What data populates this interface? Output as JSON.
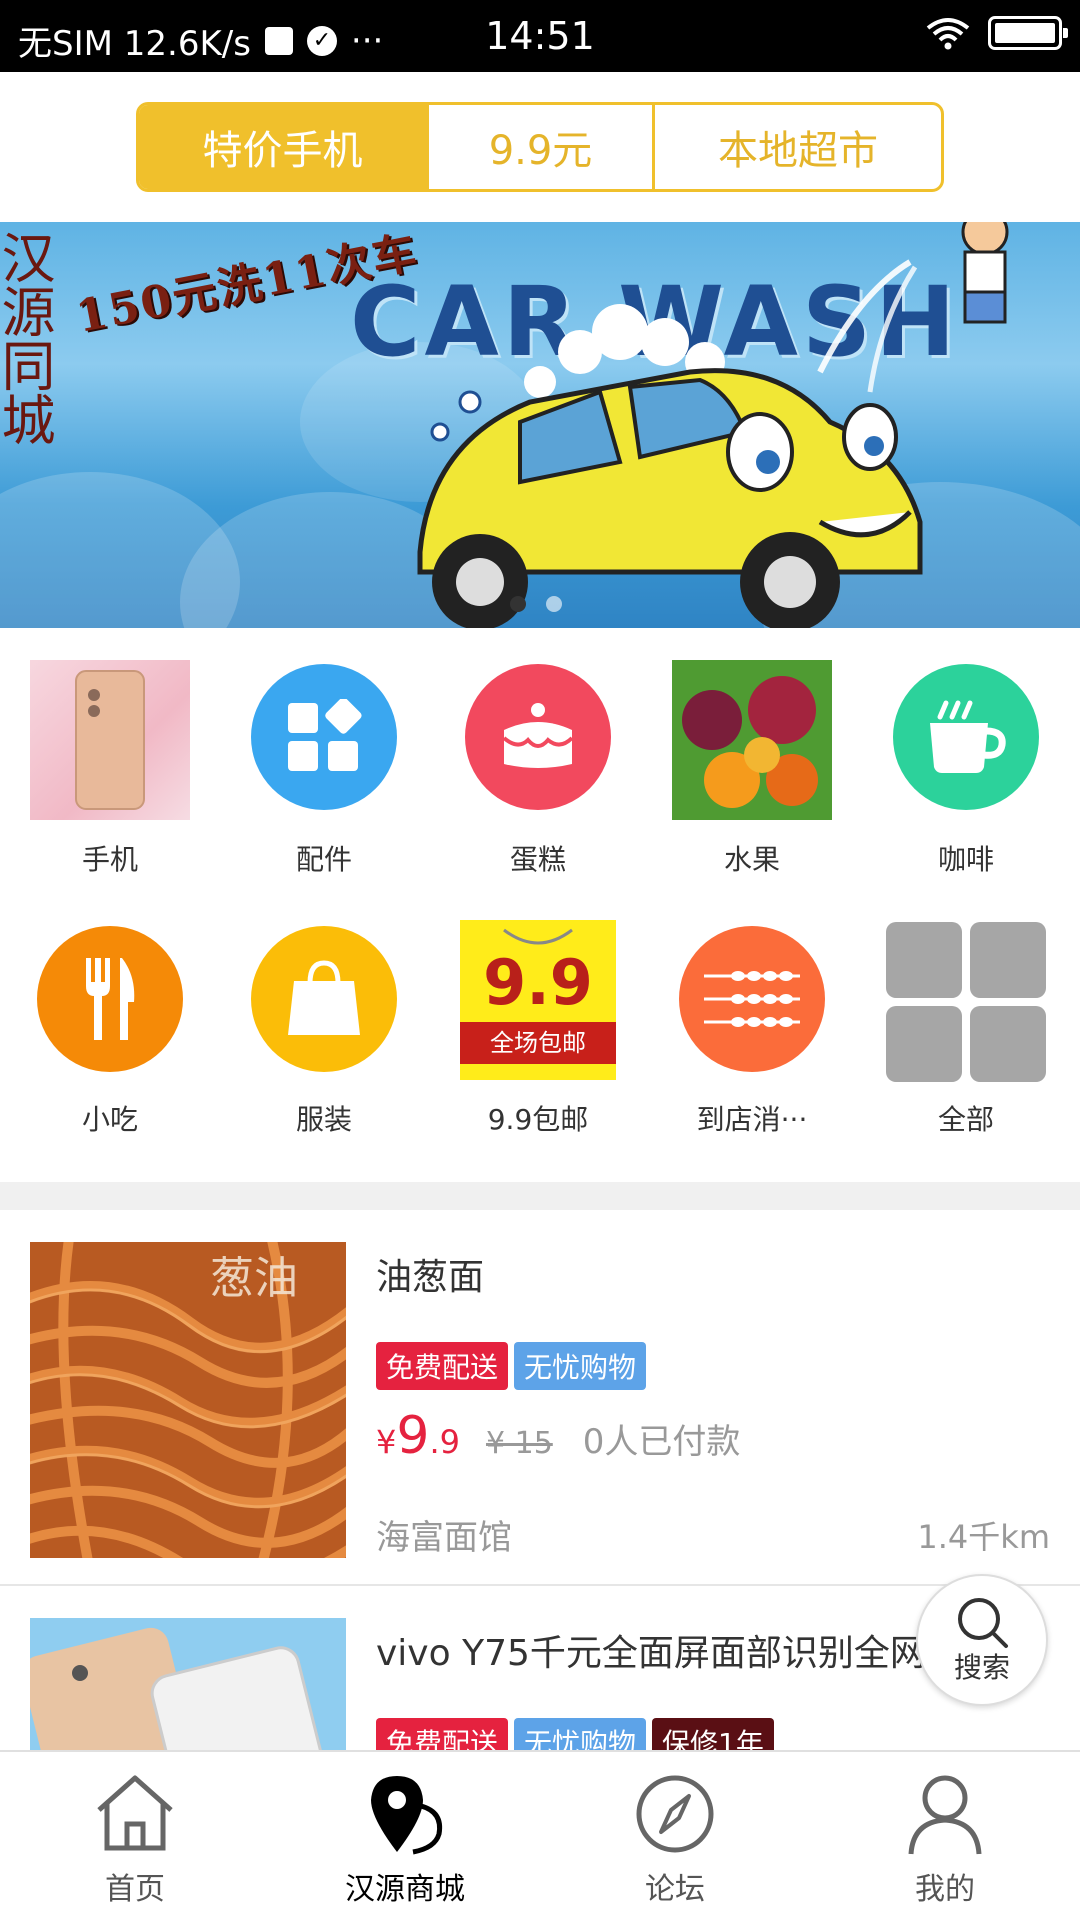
{
  "status_bar": {
    "left": "无SIM 12.6K/s",
    "more": "···",
    "time": "14:51"
  },
  "segments": [
    {
      "label": "特价手机",
      "active": true
    },
    {
      "label": "9.9元",
      "active": false
    },
    {
      "label": "本地超市",
      "active": false
    }
  ],
  "banner": {
    "side_text": "汉源同城",
    "promo_text": "150元洗11次车",
    "title": "CAR WASH",
    "slide_count": 2,
    "active_slide": 1
  },
  "categories": [
    {
      "label": "手机",
      "icon": "phone-photo"
    },
    {
      "label": "配件",
      "icon": "apps-icon",
      "color": "#3aa7f0"
    },
    {
      "label": "蛋糕",
      "icon": "cake-icon",
      "color": "#f2495e"
    },
    {
      "label": "水果",
      "icon": "fruit-photo"
    },
    {
      "label": "咖啡",
      "icon": "coffee-icon",
      "color": "#2cd29b"
    },
    {
      "label": "小吃",
      "icon": "fork-knife-icon",
      "color": "#f58a07"
    },
    {
      "label": "服装",
      "icon": "shopping-bag-icon",
      "color": "#fbbd08"
    },
    {
      "label": "9.9包邮",
      "icon": "free-shipping-badge",
      "badge_price": "9.9",
      "badge_text": "全场包邮"
    },
    {
      "label": "到店消···",
      "icon": "skewer-icon",
      "color": "#fb6c3a"
    },
    {
      "label": "全部",
      "icon": "grid-icon",
      "color": "#a6a6a6"
    }
  ],
  "products": [
    {
      "title": "油葱面",
      "tags": [
        "免费配送",
        "无忧购物"
      ],
      "price_symbol": "¥",
      "price_int": "9",
      "price_dec": ".9",
      "original_price": "¥ 15",
      "sold": "0人已付款",
      "shop": "海富面馆",
      "distance": "1.4千km",
      "image_text": "葱油"
    },
    {
      "title": "vivo Y75千元全面屏面部识别全网",
      "tags": [
        "免费配送",
        "无忧购物",
        "保修1年"
      ]
    }
  ],
  "tag_colors": {
    "免费配送": "#e5223f",
    "无忧购物": "#5da3e8",
    "保修1年": "#5a0f14"
  },
  "search_fab": {
    "label": "搜索"
  },
  "tabbar": [
    {
      "label": "首页",
      "icon": "home-icon",
      "active": false
    },
    {
      "label": "汉源商城",
      "icon": "location-pin-icon",
      "active": true
    },
    {
      "label": "论坛",
      "icon": "compass-icon",
      "active": false
    },
    {
      "label": "我的",
      "icon": "user-icon",
      "active": false
    }
  ]
}
